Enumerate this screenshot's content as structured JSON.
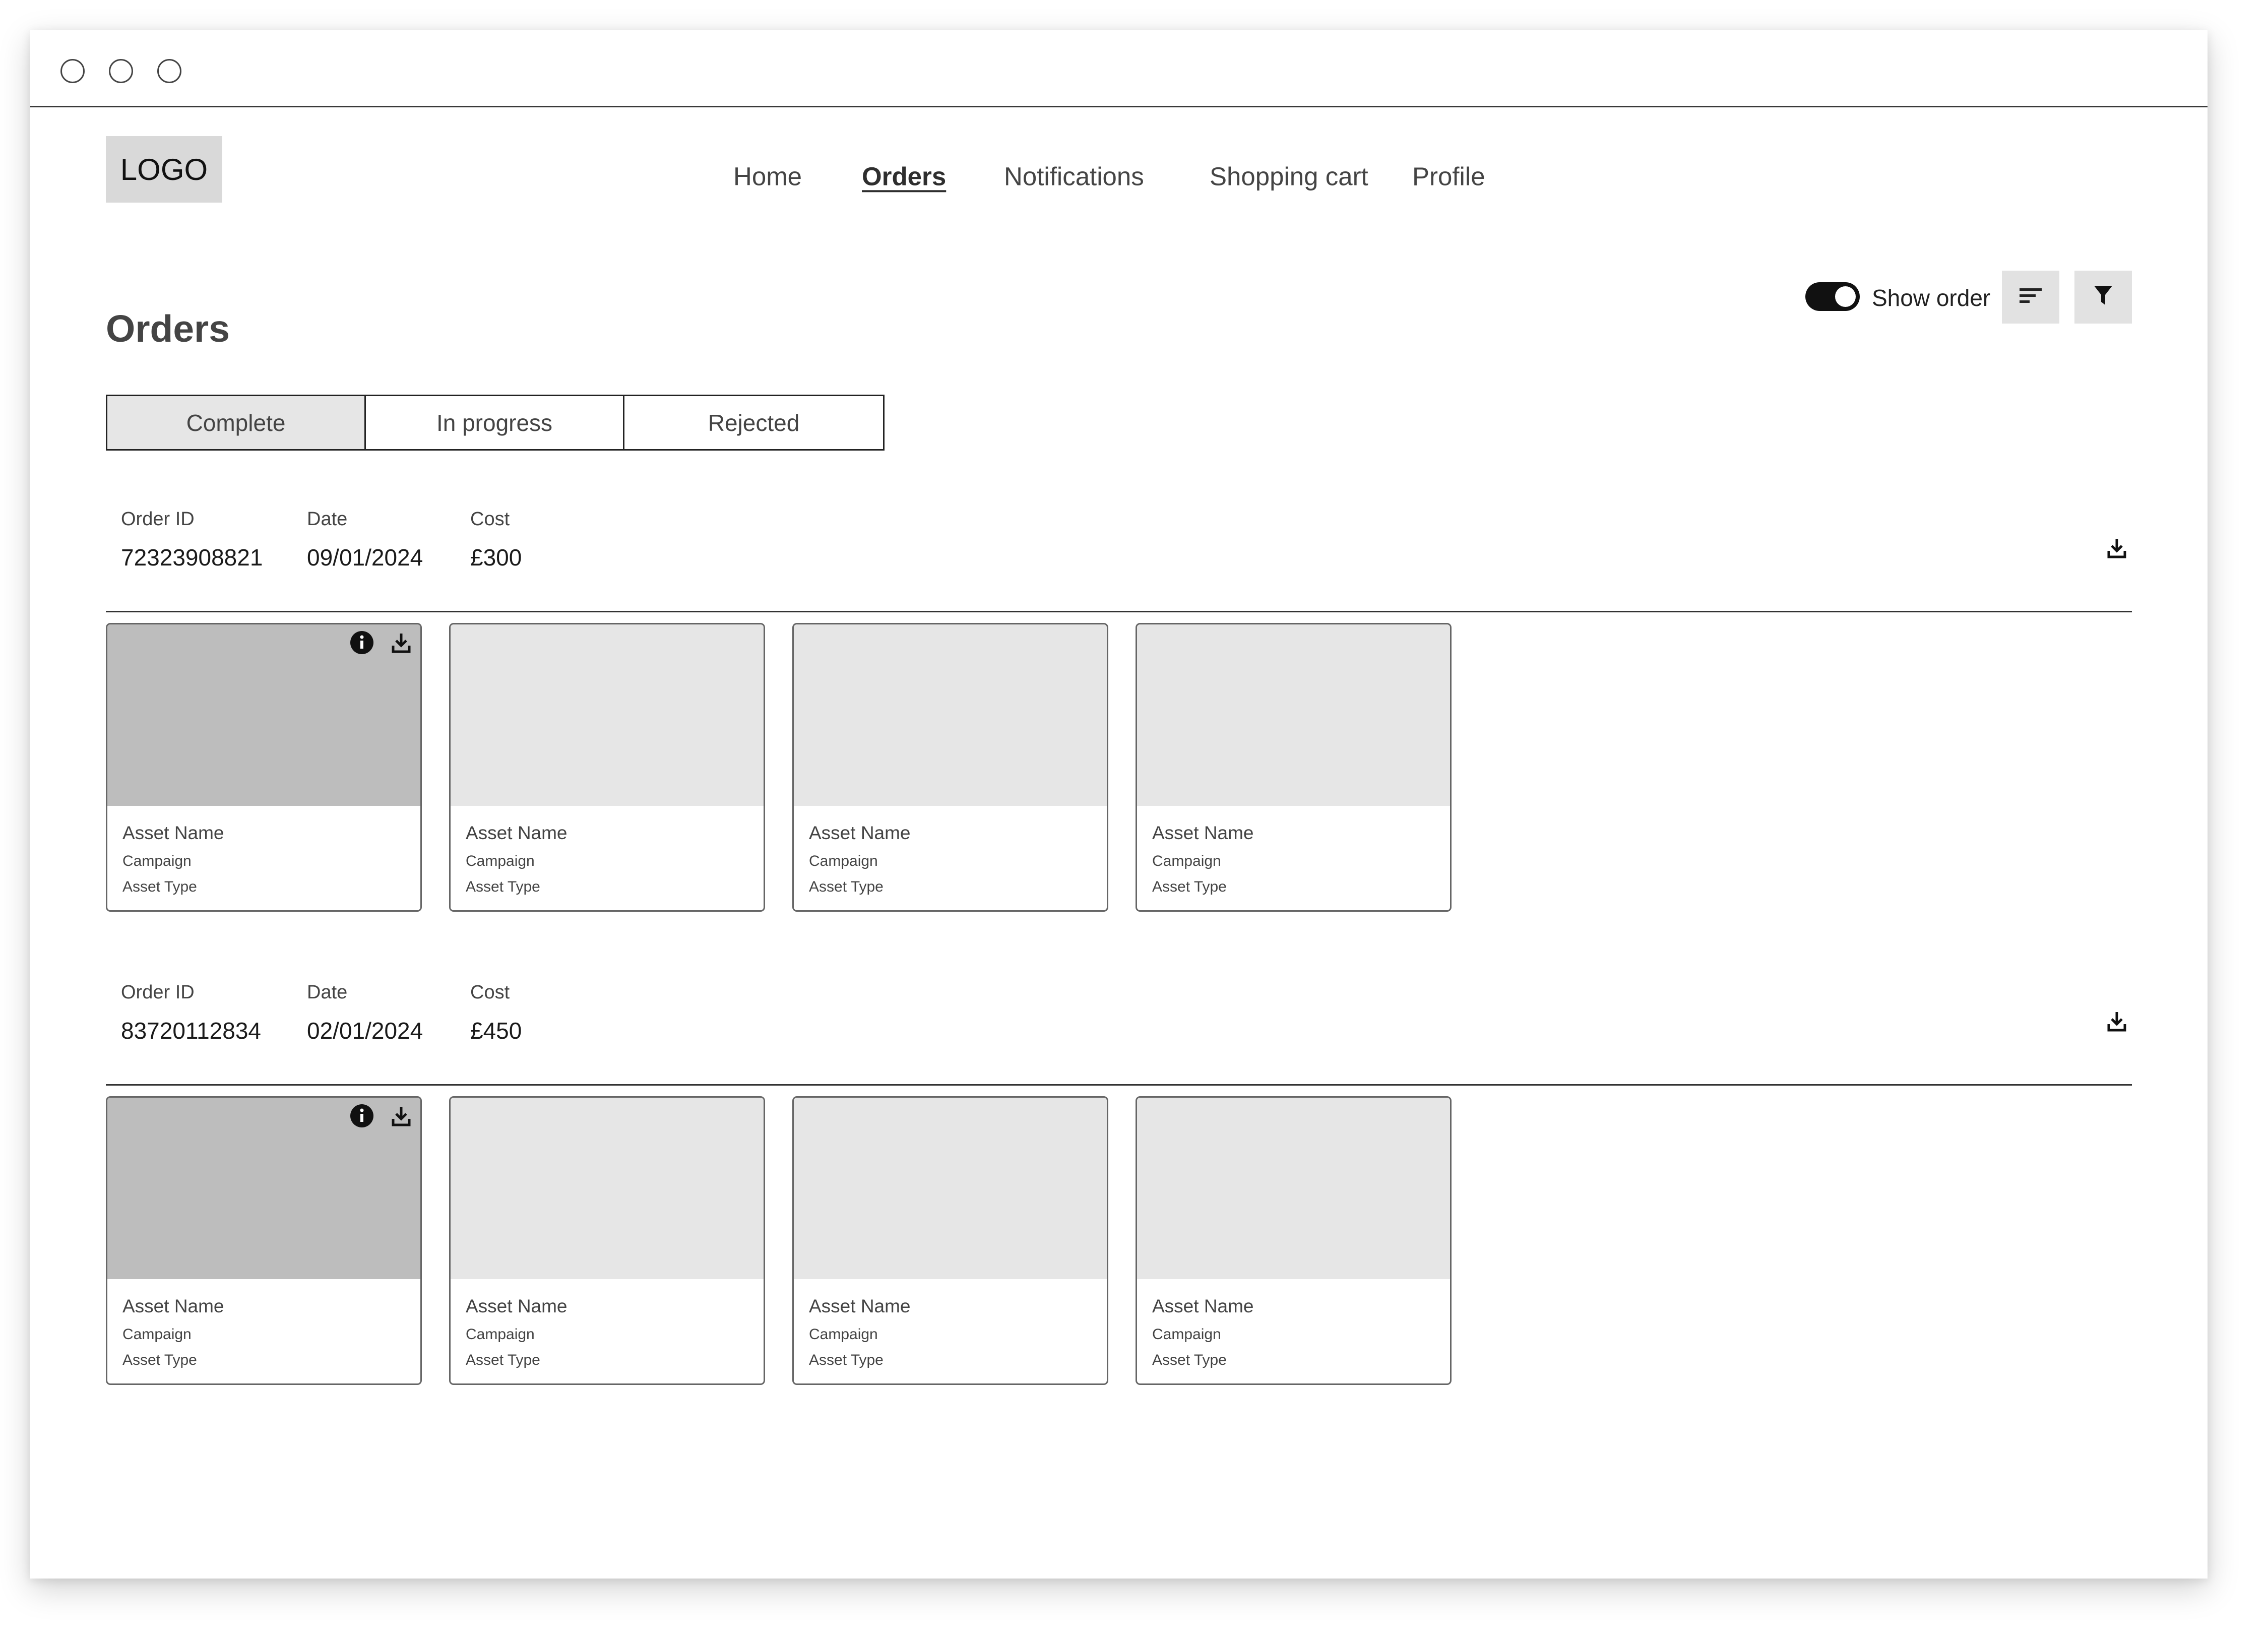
{
  "window": {
    "controls": [
      "close",
      "minimize",
      "maximize"
    ]
  },
  "header": {
    "logo": "LOGO",
    "nav": [
      {
        "label": "Home",
        "active": false
      },
      {
        "label": "Orders",
        "active": true
      },
      {
        "label": "Notifications",
        "active": false
      },
      {
        "label": "Shopping cart",
        "active": false
      },
      {
        "label": "Profile",
        "active": false
      }
    ]
  },
  "page": {
    "title": "Orders",
    "toggle": {
      "label": "Show order",
      "on": true
    },
    "sort_icon": "sort-icon",
    "filter_icon": "filter-icon"
  },
  "tabs": [
    {
      "label": "Complete",
      "active": true
    },
    {
      "label": "In progress",
      "active": false
    },
    {
      "label": "Rejected",
      "active": false
    }
  ],
  "orders": [
    {
      "id_label": "Order ID",
      "id": "72323908821",
      "date_label": "Date",
      "date": "09/01/2024",
      "cost_label": "Cost",
      "cost": "£300",
      "assets": [
        {
          "name": "Asset Name",
          "campaign": "Campaign",
          "type": "Asset Type"
        },
        {
          "name": "Asset Name",
          "campaign": "Campaign",
          "type": "Asset Type"
        },
        {
          "name": "Asset Name",
          "campaign": "Campaign",
          "type": "Asset Type"
        },
        {
          "name": "Asset Name",
          "campaign": "Campaign",
          "type": "Asset Type"
        }
      ]
    },
    {
      "id_label": "Order ID",
      "id": "83720112834",
      "date_label": "Date",
      "date": "02/01/2024",
      "cost_label": "Cost",
      "cost": "£450",
      "assets": [
        {
          "name": "Asset Name",
          "campaign": "Campaign",
          "type": "Asset Type"
        },
        {
          "name": "Asset Name",
          "campaign": "Campaign",
          "type": "Asset Type"
        },
        {
          "name": "Asset Name",
          "campaign": "Campaign",
          "type": "Asset Type"
        },
        {
          "name": "Asset Name",
          "campaign": "Campaign",
          "type": "Asset Type"
        }
      ]
    }
  ],
  "colors": {
    "thumb_selected": "#bdbdbd",
    "thumb": "#e6e6e6",
    "tab_active": "#e6e6e6",
    "icon_button": "#e2e2e2"
  }
}
